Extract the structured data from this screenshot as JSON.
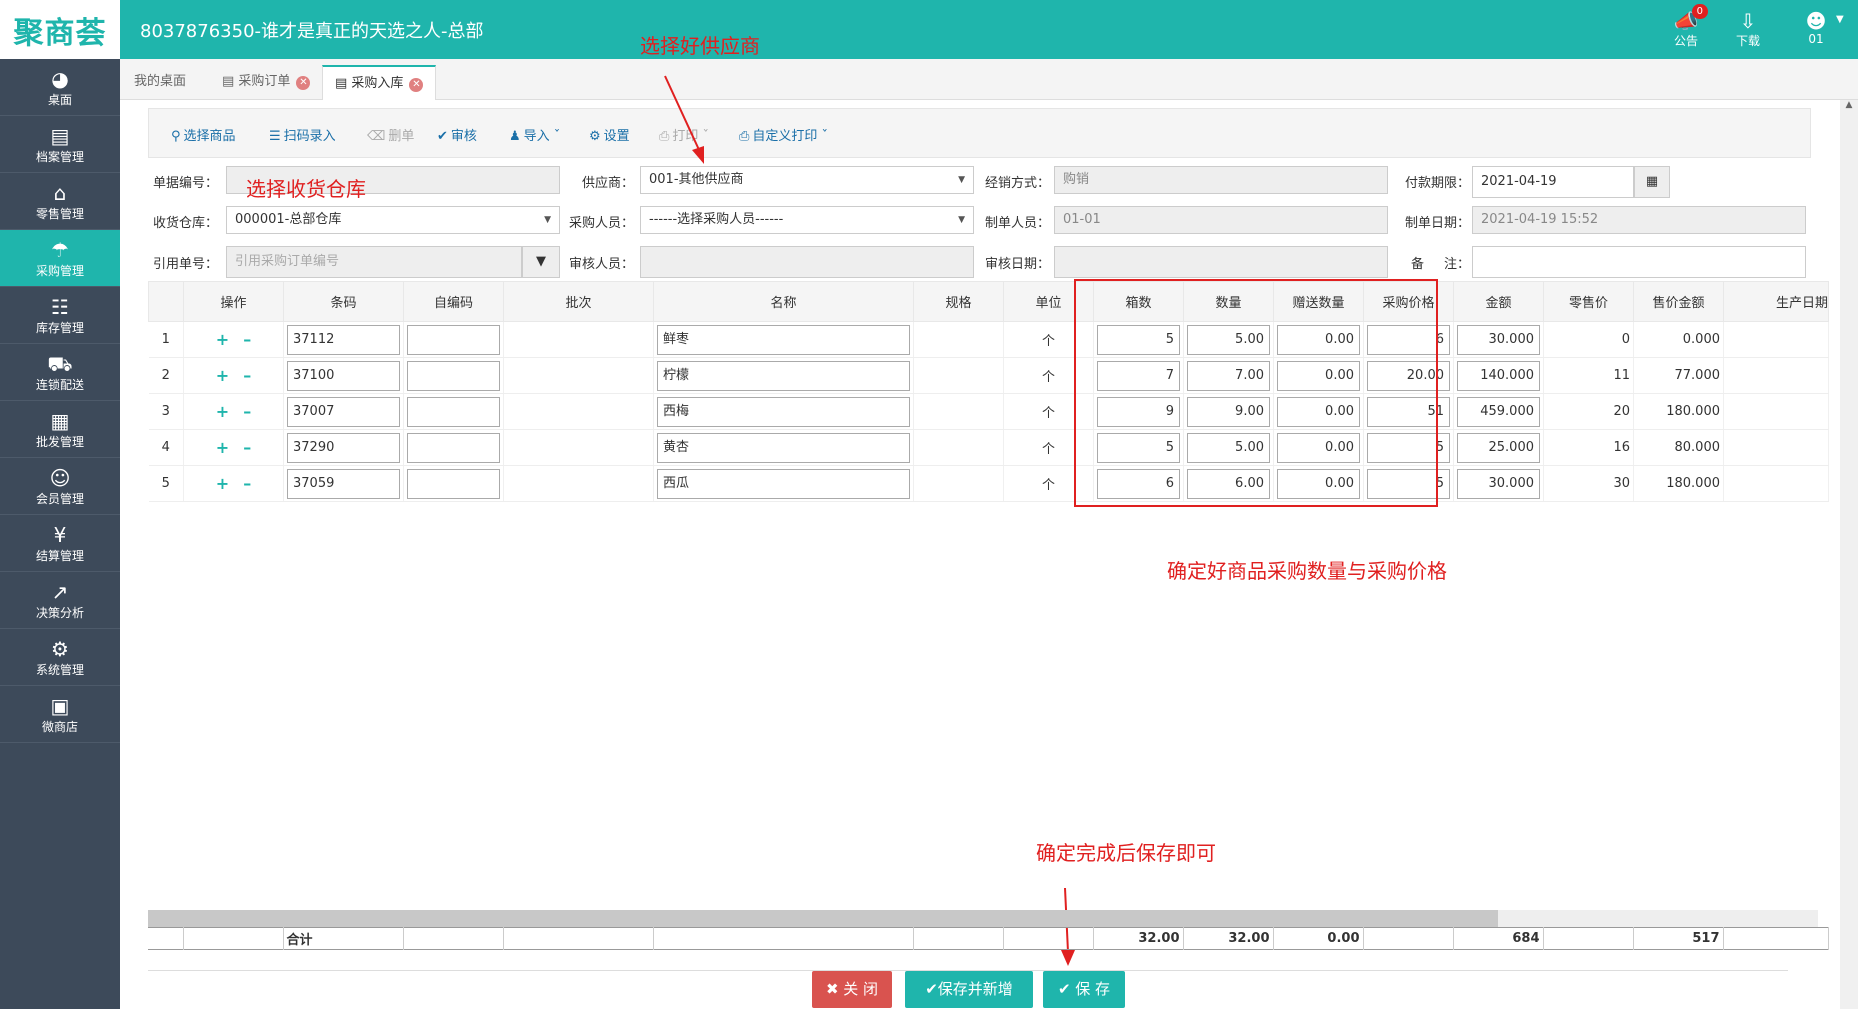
{
  "app": {
    "logo": "聚商荟",
    "title": "8037876350-谁才是真正的天选之人-总部"
  },
  "topbar": {
    "notice_label": "公告",
    "notice_count": "0",
    "download_label": "下载",
    "user_label": "01"
  },
  "sidebar": {
    "items": [
      {
        "label": "桌面",
        "icon": "dashboard-icon"
      },
      {
        "label": "档案管理",
        "icon": "file-icon"
      },
      {
        "label": "零售管理",
        "icon": "store-icon"
      },
      {
        "label": "采购管理",
        "icon": "cart-icon",
        "active": true
      },
      {
        "label": "库存管理",
        "icon": "inventory-icon"
      },
      {
        "label": "连锁配送",
        "icon": "truck-icon"
      },
      {
        "label": "批发管理",
        "icon": "wholesale-icon"
      },
      {
        "label": "会员管理",
        "icon": "member-icon"
      },
      {
        "label": "结算管理",
        "icon": "settlement-icon"
      },
      {
        "label": "决策分析",
        "icon": "chart-icon"
      },
      {
        "label": "系统管理",
        "icon": "gear-icon"
      },
      {
        "label": "微商店",
        "icon": "shop-icon"
      }
    ]
  },
  "tabs": [
    {
      "label": "我的桌面"
    },
    {
      "label": "采购订单"
    },
    {
      "label": "采购入库"
    }
  ],
  "toolbar": {
    "select_goods": "选择商品",
    "scan": "扫码录入",
    "delete": "删单",
    "audit": "审核",
    "import": "导入",
    "settings": "设置",
    "print": "打印",
    "custom_print": "自定义打印"
  },
  "form": {
    "doc_no_label": "单据编号：",
    "doc_no": "",
    "supplier_label": "供应商：",
    "supplier": "001-其他供应商",
    "mode_label": "经销方式：",
    "mode": "购销",
    "pay_label": "付款期限：",
    "pay_date": "2021-04-19",
    "warehouse_label": "收货仓库：",
    "warehouse": "000001-总部仓库",
    "buyer_label": "采购人员：",
    "buyer": "------选择采购人员------",
    "maker_label": "制单人员：",
    "maker": "01-01",
    "make_date_label": "制单日期：",
    "make_date": "2021-04-19 15:52",
    "ref_label": "引用单号：",
    "ref_placeholder": "引用采购订单编号",
    "auditor_label": "审核人员：",
    "auditor": "",
    "audit_date_label": "审核日期：",
    "audit_date": "",
    "remark_label1": "备",
    "remark_label2": "注：",
    "remark": ""
  },
  "grid": {
    "headers": [
      "",
      "操作",
      "条码",
      "自编码",
      "批次",
      "名称",
      "规格",
      "单位",
      "箱数",
      "数量",
      "赠送数量",
      "采购价格",
      "金额",
      "零售价",
      "售价金额",
      "生产日期"
    ],
    "rows": [
      {
        "no": "1",
        "barcode": "37112",
        "code": "",
        "batch": "",
        "name": "鲜枣",
        "spec": "",
        "unit": "个",
        "boxes": "5",
        "qty": "5.00",
        "gift": "0.00",
        "price": "6",
        "amount": "30.000",
        "retail": "0",
        "retail_amount": "0.000"
      },
      {
        "no": "2",
        "barcode": "37100",
        "code": "",
        "batch": "",
        "name": "柠檬",
        "spec": "",
        "unit": "个",
        "boxes": "7",
        "qty": "7.00",
        "gift": "0.00",
        "price": "20.00",
        "amount": "140.000",
        "retail": "11",
        "retail_amount": "77.000"
      },
      {
        "no": "3",
        "barcode": "37007",
        "code": "",
        "batch": "",
        "name": "西梅",
        "spec": "",
        "unit": "个",
        "boxes": "9",
        "qty": "9.00",
        "gift": "0.00",
        "price": "51",
        "amount": "459.000",
        "retail": "20",
        "retail_amount": "180.000"
      },
      {
        "no": "4",
        "barcode": "37290",
        "code": "",
        "batch": "",
        "name": "黄杏",
        "spec": "",
        "unit": "个",
        "boxes": "5",
        "qty": "5.00",
        "gift": "0.00",
        "price": "5",
        "amount": "25.000",
        "retail": "16",
        "retail_amount": "80.000"
      },
      {
        "no": "5",
        "barcode": "37059",
        "code": "",
        "batch": "",
        "name": "西瓜",
        "spec": "",
        "unit": "个",
        "boxes": "6",
        "qty": "6.00",
        "gift": "0.00",
        "price": "5",
        "amount": "30.000",
        "retail": "30",
        "retail_amount": "180.000"
      }
    ]
  },
  "totals": {
    "label": "合计",
    "boxes": "32.00",
    "qty": "32.00",
    "gift": "0.00",
    "amount": "684",
    "retail_amount": "517"
  },
  "buttons": {
    "close": "关 闭",
    "save_new": "保存并新增",
    "save": "保 存"
  },
  "annotations": {
    "supplier": "选择好供应商",
    "warehouse": "选择收货仓库",
    "qty_price": "确定好商品采购数量与采购价格",
    "save": "确定完成后保存即可"
  }
}
